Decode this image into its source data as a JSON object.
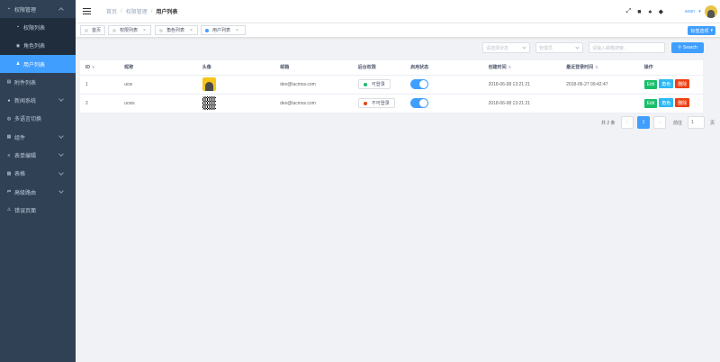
{
  "sidebar": {
    "items": [
      {
        "label": "权限管理",
        "icon": "lock-icon",
        "kind": "group",
        "expanded": true
      },
      {
        "label": "权限列表",
        "icon": "lock-icon",
        "kind": "sub"
      },
      {
        "label": "角色列表",
        "icon": "eye-icon",
        "kind": "sub"
      },
      {
        "label": "用户列表",
        "icon": "users-icon",
        "kind": "sub-active"
      },
      {
        "label": "附件列表",
        "icon": "attachment-icon",
        "kind": "plain"
      },
      {
        "label": "新闻系统",
        "icon": "news-icon",
        "kind": "group"
      },
      {
        "label": "多语言切换",
        "icon": "globe-icon",
        "kind": "plain"
      },
      {
        "label": "组件",
        "icon": "component-icon",
        "kind": "group"
      },
      {
        "label": "表单编辑",
        "icon": "form-icon",
        "kind": "group"
      },
      {
        "label": "表格",
        "icon": "table-icon",
        "kind": "group"
      },
      {
        "label": "高级路由",
        "icon": "route-icon",
        "kind": "group"
      },
      {
        "label": "错误页面",
        "icon": "error-icon",
        "kind": "plain"
      }
    ]
  },
  "header": {
    "breadcrumb": [
      "首页",
      "权限管理",
      "用户列表"
    ],
    "user_label": "aoan"
  },
  "tags": {
    "items": [
      {
        "label": "首页",
        "closable": false,
        "active": false
      },
      {
        "label": "权限列表",
        "closable": true,
        "active": false
      },
      {
        "label": "角色列表",
        "closable": true,
        "active": false
      },
      {
        "label": "用户列表",
        "closable": true,
        "active": true
      }
    ],
    "select_label": "标签选项"
  },
  "filters": {
    "status_placeholder": "请选择状态",
    "role_placeholder": "管理员",
    "email_placeholder": "请输入邮箱搜索...",
    "search_label": "Search"
  },
  "table": {
    "headers": [
      "ID",
      "昵称",
      "头像",
      "邮箱",
      "后台权限",
      "启用状态",
      "创建时间",
      "最近登录时间",
      "操作"
    ],
    "rows": [
      {
        "id": "1",
        "nick": "ucw",
        "avatar": "photo",
        "email": "dev@lucmss.com",
        "perm": "可登录",
        "perm_color": "#19be6b",
        "created": "2018-06-08 13:21:21",
        "last_login": "2018-06-27 09:42:47"
      },
      {
        "id": "2",
        "nick": "ucws",
        "avatar": "qr",
        "email": "dev@lucmss.com",
        "perm": "不可登录",
        "perm_color": "#ed4014",
        "created": "2018-06-08 13:21:21",
        "last_login": ""
      }
    ],
    "actions": {
      "edit": "Edit",
      "role": "角色",
      "delete": "删除"
    }
  },
  "pagination": {
    "total": "共 2 条",
    "prev": "‹",
    "current": "1",
    "next": "›",
    "goto_label": "前往",
    "goto_value": "1",
    "page_suffix": "页"
  },
  "colors": {
    "sidebar": "#304156",
    "accent": "#409eff"
  }
}
